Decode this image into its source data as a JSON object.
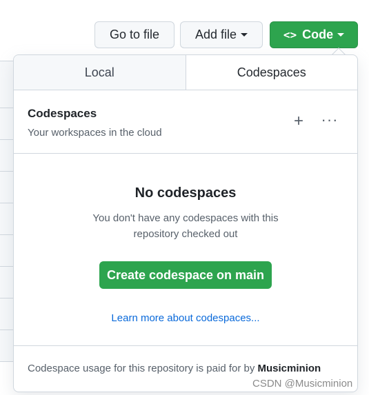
{
  "toolbar": {
    "goto_label": "Go to file",
    "add_label": "Add file",
    "code_label": "Code",
    "code_icon": "<>"
  },
  "popover": {
    "tabs": [
      {
        "label": "Local",
        "active": false
      },
      {
        "label": "Codespaces",
        "active": true
      }
    ],
    "header": {
      "title": "Codespaces",
      "subtitle": "Your workspaces in the cloud",
      "plus_icon": "+",
      "more_icon": "···"
    },
    "empty": {
      "title": "No codespaces",
      "description": "You don't have any codespaces with this repository checked out",
      "create_label": "Create codespace on main",
      "learn_link": "Learn more about codespaces..."
    },
    "footer": {
      "text": "Codespace usage for this repository is paid for by ",
      "owner": "Musicminion"
    }
  },
  "watermark": "CSDN @Musicminion",
  "colors": {
    "primary_green": "#2da44e",
    "link_blue": "#0969da",
    "border": "#d0d7de"
  }
}
